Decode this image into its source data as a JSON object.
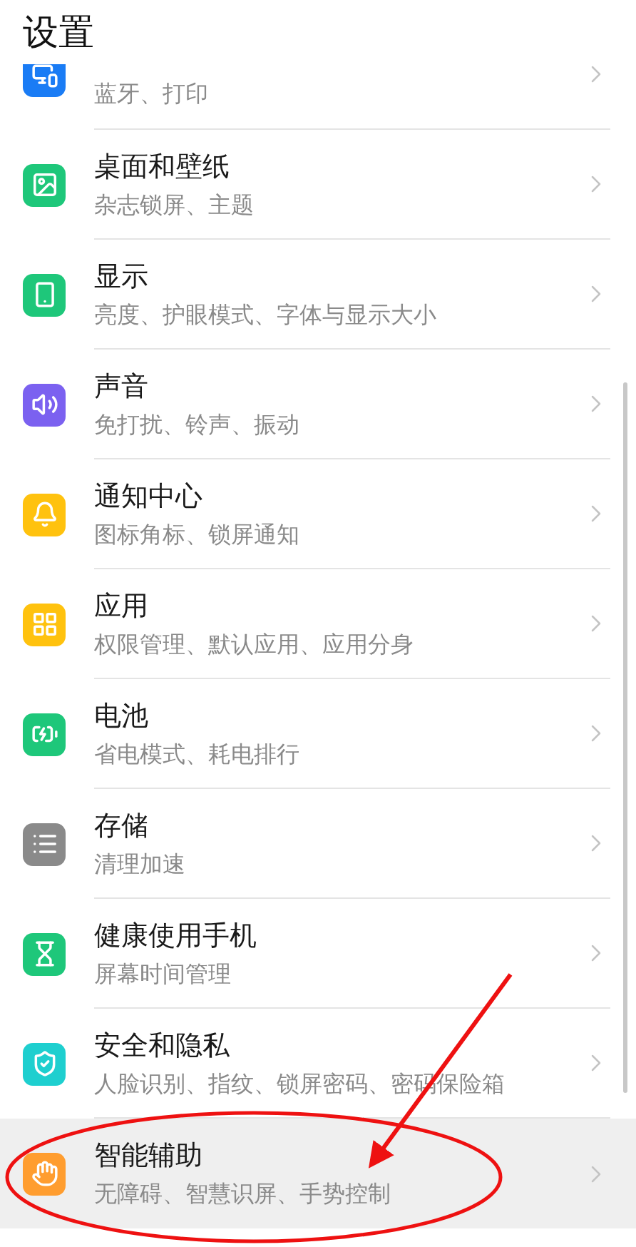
{
  "header": {
    "title": "设置"
  },
  "items": [
    {
      "subtitle": "蓝牙、打印",
      "color": "#1a7cf5",
      "selected": false
    },
    {
      "title": "桌面和壁纸",
      "subtitle": "杂志锁屏、主题",
      "color": "#1ec77a",
      "selected": false
    },
    {
      "title": "显示",
      "subtitle": "亮度、护眼模式、字体与显示大小",
      "color": "#1ec77a",
      "selected": false
    },
    {
      "title": "声音",
      "subtitle": "免打扰、铃声、振动",
      "color": "#7b61f0",
      "selected": false
    },
    {
      "title": "通知中心",
      "subtitle": "图标角标、锁屏通知",
      "color": "#ffc20e",
      "selected": false
    },
    {
      "title": "应用",
      "subtitle": "权限管理、默认应用、应用分身",
      "color": "#ffc20e",
      "selected": false
    },
    {
      "title": "电池",
      "subtitle": "省电模式、耗电排行",
      "color": "#1ec77a",
      "selected": false
    },
    {
      "title": "存储",
      "subtitle": "清理加速",
      "color": "#8a8a8a",
      "selected": false
    },
    {
      "title": "健康使用手机",
      "subtitle": "屏幕时间管理",
      "color": "#1ec77a",
      "selected": false
    },
    {
      "title": "安全和隐私",
      "subtitle": "人脸识别、指纹、锁屏密码、密码保险箱",
      "color": "#1ecfcf",
      "selected": false
    },
    {
      "title": "智能辅助",
      "subtitle": "无障碍、智慧识屏、手势控制",
      "color": "#ff9d2f",
      "selected": true
    }
  ]
}
